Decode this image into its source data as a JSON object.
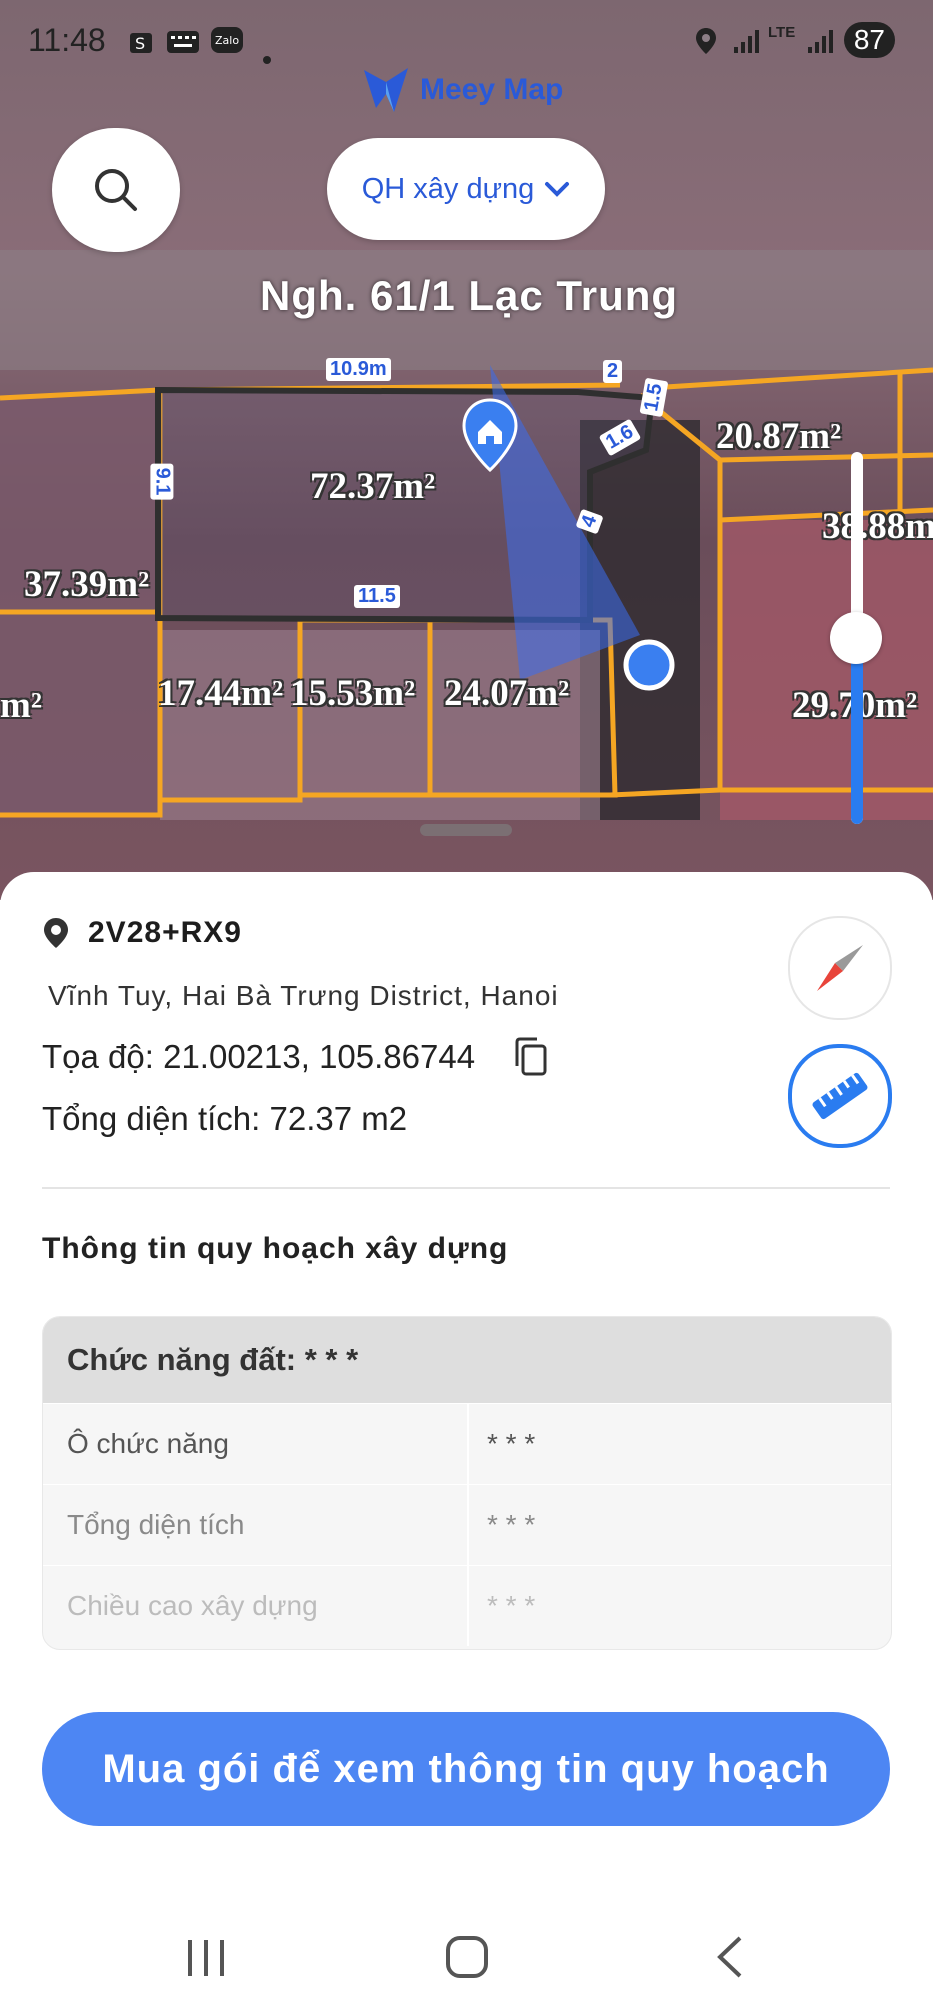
{
  "status_bar": {
    "time": "11:48",
    "battery": "87",
    "network": "LTE"
  },
  "app": {
    "logo_text": "Meey Map"
  },
  "map": {
    "layer_select_label": "QH xây dựng",
    "street_name": "Ngh. 61/1 Lạc Trung",
    "area_labels": [
      "72.37m²",
      "37.39m²",
      "20.87m²",
      "38.88m²",
      "17.44m²",
      "15.53m²",
      "24.07m²",
      "29.70m²",
      "m²"
    ],
    "dimension_labels": [
      "10.9m",
      "2",
      "1.5",
      "1.6",
      "9.1",
      "4",
      "11.5"
    ],
    "zoom_level": 0.5
  },
  "info": {
    "plus_code": "2V28+RX9",
    "address": "Vĩnh Tuy, Hai Bà Trưng District, Hanoi",
    "coord_label": "Tọa độ:",
    "coord_value": "21.00213, 105.86744",
    "area_label": "Tổng diện tích:",
    "area_value": "72.37 m2"
  },
  "planning": {
    "title": "Thông tin quy hoạch xây dựng",
    "land_function_label": "Chức năng đất: * * *",
    "rows": [
      {
        "key": "Ô chức năng",
        "value": "* * *"
      },
      {
        "key": "Tổng diện tích",
        "value": "* * *"
      },
      {
        "key": "Chiều cao xây dựng",
        "value": "* * *"
      }
    ]
  },
  "cta": {
    "label": "Mua gói để xem thông tin quy hoạch"
  },
  "colors": {
    "accent": "#4d86f3",
    "plot_outline": "#f5a623",
    "selected_outline": "#2f2f2f"
  }
}
